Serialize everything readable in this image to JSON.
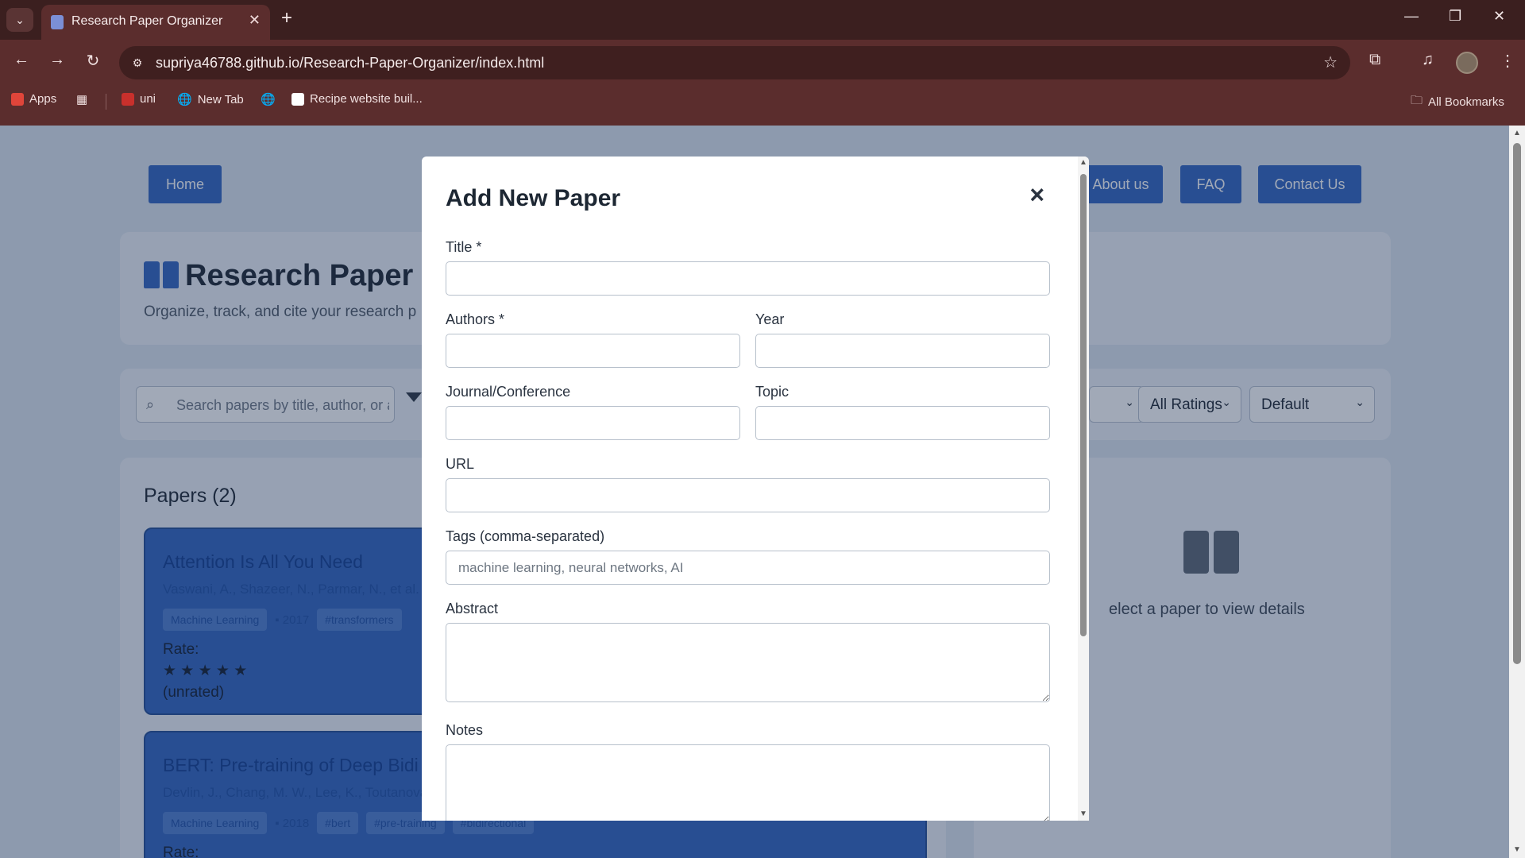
{
  "browser": {
    "tab_title": "Research Paper Organizer",
    "url": "supriya46788.github.io/Research-Paper-Organizer/index.html",
    "bookmarks": [
      "Apps",
      "uni",
      "New Tab",
      "Recipe website buil..."
    ],
    "all_bookmarks": "All Bookmarks"
  },
  "nav": {
    "home": "Home",
    "about": "About us",
    "faq": "FAQ",
    "contact": "Contact Us"
  },
  "hero": {
    "title": "Research Paper O",
    "subtitle": "Organize, track, and cite your research p"
  },
  "filters": {
    "search_placeholder": "Search papers by title, author, or a",
    "ratings": "All Ratings",
    "sort": "Default"
  },
  "papers": {
    "heading": "Papers (2)",
    "items": [
      {
        "title": "Attention Is All You Need",
        "authors": "Vaswani, A., Shazeer, N., Parmar, N., et al.",
        "topic": "Machine Learning",
        "year": "2017",
        "tags": [
          "#transformers"
        ],
        "rate_label": "Rate:",
        "stars": "★ ★ ★ ★ ★",
        "status": "(unrated)"
      },
      {
        "title": "BERT: Pre-training of Deep Bidi",
        "authors": "Devlin, J., Chang, M. W., Lee, K., Toutanova",
        "topic": "Machine Learning",
        "year": "2018",
        "tags": [
          "#bert",
          "#pre-training",
          "#bidirectional"
        ],
        "rate_label": "Rate:"
      }
    ]
  },
  "details": {
    "empty_text": "elect a paper to view details"
  },
  "modal": {
    "title": "Add New Paper",
    "close": "×",
    "title_label": "Title *",
    "authors_label": "Authors *",
    "year_label": "Year",
    "journal_label": "Journal/Conference",
    "topic_label": "Topic",
    "url_label": "URL",
    "tags_label": "Tags (comma-separated)",
    "tags_placeholder": "machine learning, neural networks, AI",
    "abstract_label": "Abstract",
    "notes_label": "Notes"
  },
  "colors": {
    "accent": "#2f63bf",
    "chrome": "#5b2d2d"
  }
}
